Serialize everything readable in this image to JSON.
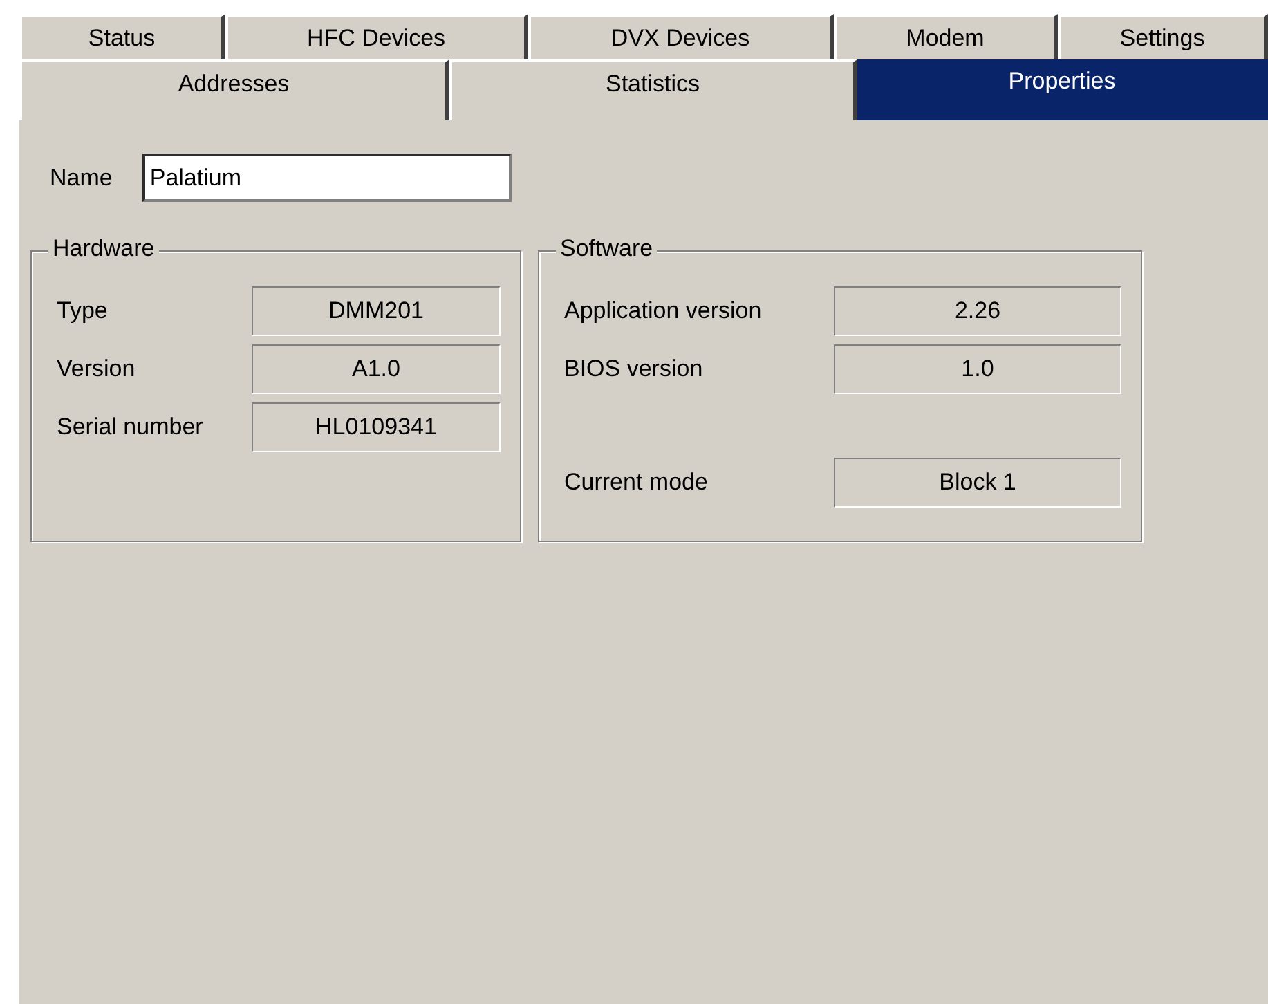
{
  "tab_rows": [
    [
      {
        "label": "Status",
        "selected": false
      },
      {
        "label": "HFC Devices",
        "selected": false
      },
      {
        "label": "DVX Devices",
        "selected": false
      },
      {
        "label": "Modem",
        "selected": false
      },
      {
        "label": "Settings",
        "selected": false
      }
    ],
    [
      {
        "label": "Addresses",
        "selected": false
      },
      {
        "label": "Statistics",
        "selected": false
      },
      {
        "label": "Properties",
        "selected": true
      }
    ]
  ],
  "name_field": {
    "label": "Name",
    "value": "Palatium"
  },
  "groups": [
    {
      "title": "Hardware",
      "rows": [
        {
          "label": "Type",
          "value": "DMM201"
        },
        {
          "label": "Version",
          "value": "A1.0"
        },
        {
          "label": "Serial number",
          "value": "HL0109341"
        }
      ]
    },
    {
      "title": "Software",
      "rows": [
        {
          "label": "Application version",
          "value": "2.26"
        },
        {
          "label": "BIOS version",
          "value": "1.0"
        },
        {
          "label": "Current mode",
          "value": "Block 1"
        }
      ]
    }
  ]
}
